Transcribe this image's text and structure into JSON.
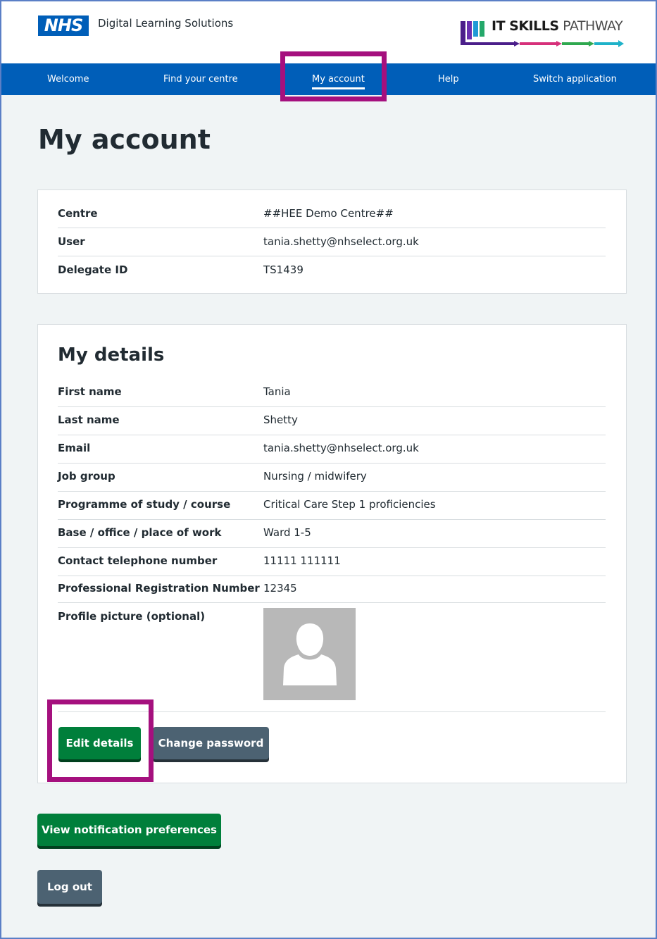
{
  "header": {
    "nhs_logo": "NHS",
    "service_name": "Digital Learning Solutions",
    "brand_strong": "IT SKILLS",
    "brand_light": "PATHWAY"
  },
  "nav": {
    "items": [
      {
        "label": "Welcome"
      },
      {
        "label": "Find your centre"
      },
      {
        "label": "My account"
      },
      {
        "label": "Help"
      },
      {
        "label": "Switch application"
      }
    ],
    "active_index": 2
  },
  "page_title": "My account",
  "account_summary": [
    {
      "label": "Centre",
      "value": "##HEE Demo Centre##"
    },
    {
      "label": "User",
      "value": "tania.shetty@nhselect.org.uk"
    },
    {
      "label": "Delegate ID",
      "value": "TS1439"
    }
  ],
  "details": {
    "heading": "My details",
    "rows": [
      {
        "label": "First name",
        "value": "Tania"
      },
      {
        "label": "Last name",
        "value": "Shetty"
      },
      {
        "label": "Email",
        "value": "tania.shetty@nhselect.org.uk"
      },
      {
        "label": "Job group",
        "value": "Nursing / midwifery"
      },
      {
        "label": "Programme of study / course",
        "value": "Critical Care Step 1 proficiencies"
      },
      {
        "label": "Base / office / place of work",
        "value": "Ward 1-5"
      },
      {
        "label": "Contact telephone number",
        "value": "11111 111111"
      },
      {
        "label": "Professional Registration Number",
        "value": "12345"
      }
    ],
    "profile_picture_label": "Profile picture (optional)",
    "edit_button": "Edit details",
    "change_password_button": "Change password"
  },
  "buttons": {
    "notifications": "View notification preferences",
    "logout": "Log out"
  },
  "colors": {
    "nhs_blue": "#005eb8",
    "button_green": "#007f3b",
    "button_grey": "#4c6272",
    "highlight": "#a5107e",
    "page_background": "#f0f4f5"
  }
}
